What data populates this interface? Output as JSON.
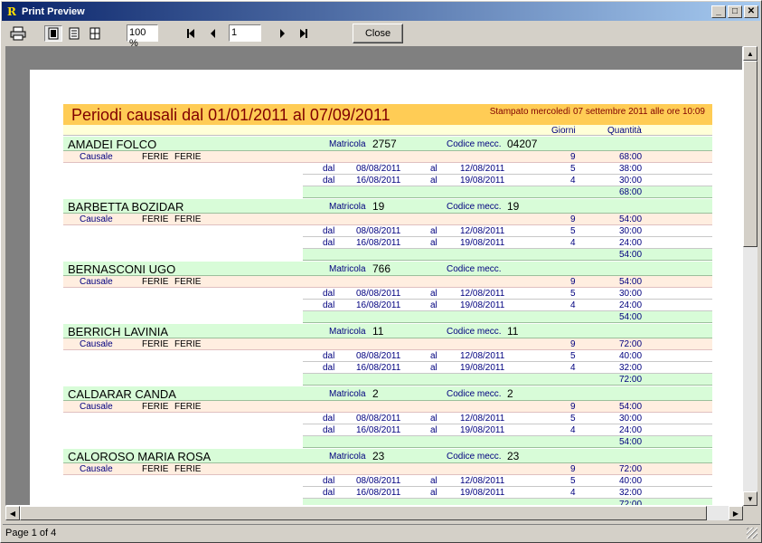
{
  "window": {
    "title": "Print Preview",
    "app_icon": "R"
  },
  "toolbar": {
    "zoom": "100 %",
    "page": "1",
    "close_label": "Close"
  },
  "status": {
    "text": "Page 1 of 4"
  },
  "report": {
    "title": "Periodi causali dal 01/01/2011 al 07/09/2011",
    "printed": "Stampato mercoledì 07 settembre 2011 alle ore 10:09",
    "col_giorni": "Giorni",
    "col_quantita": "Quantità",
    "lbl_matricola": "Matricola",
    "lbl_codice": "Codice mecc.",
    "lbl_causale": "Causale",
    "lbl_dal": "dal",
    "lbl_al": "al",
    "employees": [
      {
        "name": "AMADEI FOLCO",
        "matricola": "2757",
        "codice": "04207",
        "causale1": "FERIE",
        "causale2": "FERIE",
        "giorni": "9",
        "qta": "68:00",
        "rows": [
          {
            "dal": "08/08/2011",
            "al": "12/08/2011",
            "giorni": "5",
            "qta": "38:00"
          },
          {
            "dal": "16/08/2011",
            "al": "19/08/2011",
            "giorni": "4",
            "qta": "30:00"
          }
        ],
        "total": "68:00"
      },
      {
        "name": "BARBETTA BOZIDAR",
        "matricola": "19",
        "codice": "19",
        "causale1": "FERIE",
        "causale2": "FERIE",
        "giorni": "9",
        "qta": "54:00",
        "rows": [
          {
            "dal": "08/08/2011",
            "al": "12/08/2011",
            "giorni": "5",
            "qta": "30:00"
          },
          {
            "dal": "16/08/2011",
            "al": "19/08/2011",
            "giorni": "4",
            "qta": "24:00"
          }
        ],
        "total": "54:00"
      },
      {
        "name": "BERNASCONI UGO",
        "matricola": "766",
        "codice": "",
        "causale1": "FERIE",
        "causale2": "FERIE",
        "giorni": "9",
        "qta": "54:00",
        "rows": [
          {
            "dal": "08/08/2011",
            "al": "12/08/2011",
            "giorni": "5",
            "qta": "30:00"
          },
          {
            "dal": "16/08/2011",
            "al": "19/08/2011",
            "giorni": "4",
            "qta": "24:00"
          }
        ],
        "total": "54:00"
      },
      {
        "name": "BERRICH LAVINIA",
        "matricola": "11",
        "codice": "11",
        "causale1": "FERIE",
        "causale2": "FERIE",
        "giorni": "9",
        "qta": "72:00",
        "rows": [
          {
            "dal": "08/08/2011",
            "al": "12/08/2011",
            "giorni": "5",
            "qta": "40:00"
          },
          {
            "dal": "16/08/2011",
            "al": "19/08/2011",
            "giorni": "4",
            "qta": "32:00"
          }
        ],
        "total": "72:00"
      },
      {
        "name": "CALDARAR CANDA",
        "matricola": "2",
        "codice": "2",
        "causale1": "FERIE",
        "causale2": "FERIE",
        "giorni": "9",
        "qta": "54:00",
        "rows": [
          {
            "dal": "08/08/2011",
            "al": "12/08/2011",
            "giorni": "5",
            "qta": "30:00"
          },
          {
            "dal": "16/08/2011",
            "al": "19/08/2011",
            "giorni": "4",
            "qta": "24:00"
          }
        ],
        "total": "54:00"
      },
      {
        "name": "CALOROSO MARIA ROSA",
        "matricola": "23",
        "codice": "23",
        "causale1": "FERIE",
        "causale2": "FERIE",
        "giorni": "9",
        "qta": "72:00",
        "rows": [
          {
            "dal": "08/08/2011",
            "al": "12/08/2011",
            "giorni": "5",
            "qta": "40:00"
          },
          {
            "dal": "16/08/2011",
            "al": "19/08/2011",
            "giorni": "4",
            "qta": "32:00"
          }
        ],
        "total": "72:00"
      }
    ]
  }
}
